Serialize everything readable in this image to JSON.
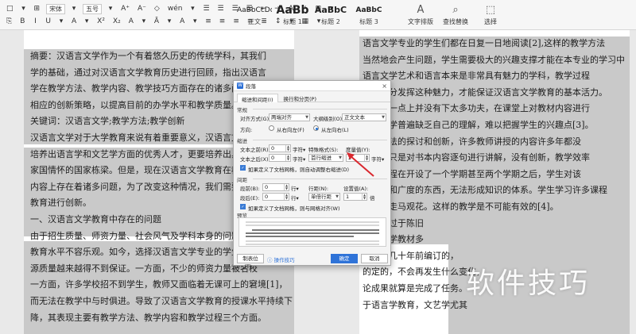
{
  "ribbon": {
    "row1": [
      "□",
      "▾",
      "⊞",
      "宋体",
      "▾",
      "五号",
      "▾",
      "A⁺",
      "A⁻",
      "◇",
      "wén",
      "▾",
      "☰",
      "☰",
      "☰",
      "☰",
      "⇤",
      "⇥",
      "A",
      "✓",
      "⊞",
      "▾"
    ],
    "row2": [
      "⎘",
      "B",
      "I",
      "U",
      "▾",
      "A",
      "▾",
      "X²",
      "X₂",
      "A",
      "▾",
      "Ā",
      "▾",
      "A",
      "▾",
      "≡",
      "≡",
      "≡",
      "≡",
      "≣",
      "↕",
      "▾",
      "▦",
      "▾"
    ],
    "styles": [
      {
        "preview": "AaBbCcDd",
        "label": "正文"
      },
      {
        "preview": "AaBb",
        "label": "标题 1"
      },
      {
        "preview": "AaBbC",
        "label": "标题 2"
      },
      {
        "preview": "AaBbC",
        "label": "标题 3"
      }
    ],
    "tools": [
      {
        "icon": "A",
        "label": "文字排版"
      },
      {
        "icon": "⌕",
        "label": "查找替换"
      },
      {
        "icon": "⬚",
        "label": "选择"
      }
    ]
  },
  "left_page": {
    "lines": [
      "摘要：汉语言文学作为一个有着悠久历史的传统学科，其我们",
      "学的基础，通过对汉语言文学教育历史进行回顾，指出汉语言",
      "学在教学方法、教学内容、教学技巧方面存在的诸多问题，并",
      "相应的创新策略，以提高目前的办学水平和教学质量。",
      "关键词：汉语言文学;教学方法;教学创新",
      "汉语言文学对于大学教育来说有着重要意义，汉语言文学",
      "培养出语言学和文艺学方面的优秀人才，更要培养出具有民",
      "家国情怀的国家栋梁。但是，现在汉语言文学教育在教学水",
      "内容上存在着诸多问题，为了改变这种情况，我们需要对汉",
      "教育进行创新。",
      "一、汉语言文学教育中存在的问题",
      "由于招生质量、师资力量、社会风气及学科本身的问题，汉",
      "教育水平不容乐观。如今，选择汉语言文学专业的学生越来",
      "源质量越来越得不到保证。一方面，不少的师资力量被名校",
      "一方面，许多学校招不到学生，教师又面临着无课可上的窘境[1]，",
      "而无法在教学中与时俱进。导致了汉语言文学教育的授课水平持续下",
      "降，其表现主要有教学方法、教学内容和教学过程三个方面。"
    ]
  },
  "right_page": {
    "lines": [
      "语言文学专业的学生们都在日复一日地阅读[2],这样的教学方法",
      "当然地会产生问题，学生需要极大的兴趣支撑才能在本专业的学习中",
      "语言文学艺术和语言本来是非常具有魅力的学科，教学过程",
      "相关部分发挥这种魅力，才能保证汉语言文学教育的基本活力。",
      "语在这一点上并没有下太多功夫，在课堂上对教材内容进行",
      "语言文学普遍缺乏自己的理解，难以把握学生的兴趣点[3]。",
      "教学方法的探讨和创新，许多教师讲授的内容许多年都没",
      "变学时只是对书本内容逐句进行讲解，没有创新，教学效率",
      "有的课程在开设了一个学期甚至两个学期之后，学生对该",
      "的深度和广度的东西，无法形成知识的体系。学生学习许多课程",
      "走马，走马观花。这样的教学是不可能有效的[4]。",
      "学内容过于陈旧",
      "语言文学教材多",
      "甚至是几十年前编订的，",
      "的定的，不会再发生什么变化，",
      "论成果就算是完成了任务。",
      "于语言学教育，文艺学尤其"
    ]
  },
  "dialog": {
    "title": "段落",
    "close": "×",
    "tabs": [
      "缩进和间距(I)",
      "换行和分页(P)"
    ],
    "sections": {
      "general": "常规",
      "indent": "缩进",
      "spacing": "间距",
      "preview": "预览"
    },
    "align_label": "对齐方式(G):",
    "align_value": "两端对齐",
    "outline_label": "大纲级别(O):",
    "outline_value": "正文文本",
    "direction_label": "方向:",
    "dir_rtl": "从右向左(F)",
    "dir_ltr": "从左向右(L)",
    "before_text_label": "文本之前(R):",
    "before_text_value": "0",
    "after_text_label": "文本之后(X):",
    "after_text_value": "0",
    "unit_char": "字符▾",
    "special_label": "特殊格式(S):",
    "special_value": "首行缩进",
    "measure_label": "度量值(Y):",
    "measure_value": "2",
    "grid_indent_check": "如果定义了文档网格，则自动调整右缩进(D)",
    "before_para_label": "段前(B):",
    "before_para_value": "0",
    "after_para_label": "段后(E):",
    "after_para_value": "0",
    "unit_line": "行▾",
    "line_spacing_label": "行距(N):",
    "line_spacing_value": "单倍行距",
    "set_value_label": "设置值(A):",
    "set_value": "1",
    "unit_times": "倍",
    "grid_align_check": "如果定义了文档网格，则与网格对齐(W)",
    "tabs_button": "制表位(T)...",
    "tips": "操作技巧",
    "ok": "确定",
    "cancel": "取消"
  },
  "watermark": "软件技巧",
  "colors": {
    "accent": "#2f73d8",
    "annotation": "#d9272e",
    "highlight": "#c9c9c9"
  }
}
